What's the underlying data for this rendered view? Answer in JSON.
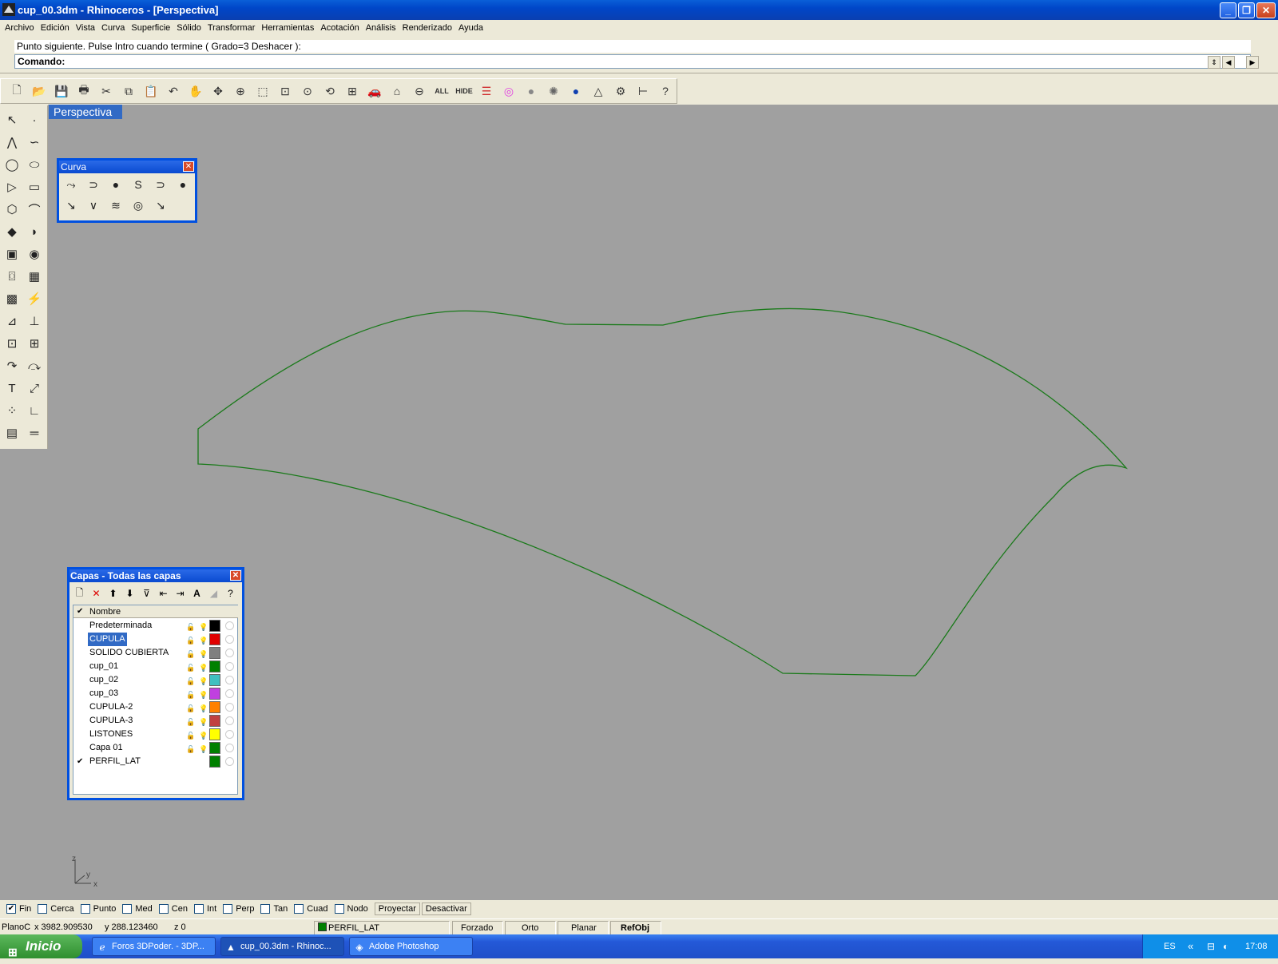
{
  "window": {
    "title": "cup_00.3dm - Rhinoceros - [Perspectiva]"
  },
  "menu": [
    "Archivo",
    "Edición",
    "Vista",
    "Curva",
    "Superficie",
    "Sólido",
    "Transformar",
    "Herramientas",
    "Acotación",
    "Análisis",
    "Renderizado",
    "Ayuda"
  ],
  "command": {
    "history": "Punto siguiente. Pulse Intro cuando termine ( Grado=3  Deshacer ):",
    "prompt": "Comando:"
  },
  "toolbar": {
    "all_label": "ALL",
    "hide_label": "HIDE"
  },
  "viewport": {
    "name": "Perspectiva",
    "axis_x": "x",
    "axis_y": "y",
    "axis_z": "z"
  },
  "curve_panel": {
    "title": "Curva"
  },
  "layers": {
    "title": "Capas - Todas las capas",
    "column_name": "Nombre",
    "rows": [
      {
        "name": "Predeterminada",
        "color": "#000000",
        "selected": false,
        "current": false
      },
      {
        "name": "CUPULA",
        "color": "#e00000",
        "selected": true,
        "current": false
      },
      {
        "name": "SOLIDO CUBIERTA",
        "color": "#808080",
        "selected": false,
        "current": false
      },
      {
        "name": "cup_01",
        "color": "#008000",
        "selected": false,
        "current": false
      },
      {
        "name": "cup_02",
        "color": "#40c0c0",
        "selected": false,
        "current": false
      },
      {
        "name": "cup_03",
        "color": "#c040e0",
        "selected": false,
        "current": false
      },
      {
        "name": "CUPULA-2",
        "color": "#ff8000",
        "selected": false,
        "current": false
      },
      {
        "name": "CUPULA-3",
        "color": "#c04040",
        "selected": false,
        "current": false
      },
      {
        "name": "LISTONES",
        "color": "#ffff00",
        "selected": false,
        "current": false
      },
      {
        "name": "Capa 01",
        "color": "#008000",
        "selected": false,
        "current": false
      },
      {
        "name": "PERFIL_LAT",
        "color": "#008000",
        "selected": false,
        "current": true
      }
    ]
  },
  "osnap": {
    "items": [
      {
        "label": "Fin",
        "checked": true
      },
      {
        "label": "Cerca",
        "checked": false
      },
      {
        "label": "Punto",
        "checked": false
      },
      {
        "label": "Med",
        "checked": false
      },
      {
        "label": "Cen",
        "checked": false
      },
      {
        "label": "Int",
        "checked": false
      },
      {
        "label": "Perp",
        "checked": false
      },
      {
        "label": "Tan",
        "checked": false
      },
      {
        "label": "Cuad",
        "checked": false
      },
      {
        "label": "Nodo",
        "checked": false
      }
    ],
    "project_label": "Proyectar",
    "disable_label": "Desactivar"
  },
  "status": {
    "cplane": "PlanoC",
    "x": "x 3982.909530",
    "y": "y 288.123460",
    "z": "z 0",
    "layer": "PERFIL_LAT",
    "layer_color": "#008000",
    "forced": "Forzado",
    "ortho": "Orto",
    "planar": "Planar",
    "refobj": "RefObj"
  },
  "taskbar": {
    "start": "Inicio",
    "tasks": [
      "Foros 3DPoder. - 3DP...",
      "cup_00.3dm - Rhinoc...",
      "Adobe Photoshop"
    ],
    "lang": "ES",
    "clock": "17:08"
  },
  "colors": {
    "curve": "#1a7a1a",
    "viewport_bg": "#a0a0a0",
    "xp_blue": "#0050e0"
  }
}
